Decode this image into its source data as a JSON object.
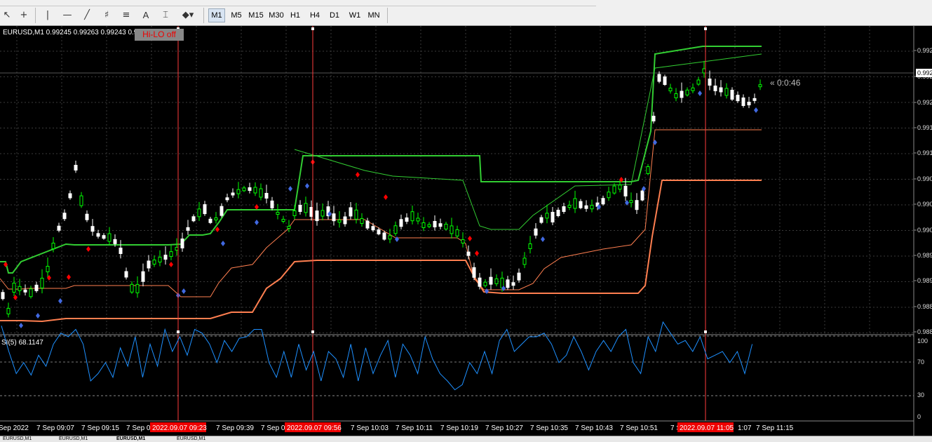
{
  "toolbar": {
    "timeframes": [
      "M1",
      "M5",
      "M15",
      "M30",
      "H1",
      "H4",
      "D1",
      "W1",
      "MN"
    ],
    "active_timeframe": "M1",
    "tools": [
      "cursor-icon",
      "crosshair-icon",
      "vertical-line-icon",
      "horizontal-line-icon",
      "trendline-icon",
      "fibonacci-fan-icon",
      "fibonacci-retracement-icon",
      "text-icon",
      "text-label-icon",
      "shapes-dropdown-icon"
    ]
  },
  "chart": {
    "symbol_info": "EURUSD,M1  0.99245 0.99263 0.99243 0.99",
    "hilo_button": "Hi-LO off",
    "countdown": "« 0:0:46",
    "current_price_label": "0.992",
    "price_axis": [
      "0.992",
      "0.992",
      "0.992",
      "0.991",
      "0.991",
      "0.990",
      "0.990",
      "0.990",
      "0.989",
      "0.989",
      "0.988",
      "0.988"
    ],
    "rsi_label": "SI(5) 68.1147",
    "rsi_axis": [
      "100",
      "70",
      "30",
      "0"
    ],
    "time_axis": [
      "Sep 2022",
      "7 Sep 09:07",
      "7 Sep 09:15",
      "7 Sep 0",
      "7 Sep 09:39",
      "7 Sep 0",
      "7 Sep 10:03",
      "7 Sep 10:11",
      "7 Sep 10:19",
      "7 Sep 10:27",
      "7 Sep 10:35",
      "7 Sep 10:43",
      "7 Sep 10:51",
      "7 Se",
      "1:07",
      "7 Sep 11:15"
    ],
    "vline_labels": [
      "2022.09.07 09:23",
      "2022.09.07 09:56",
      "2022.09.07 11:05"
    ],
    "colors": {
      "background": "#000000",
      "bull": "#ffffff",
      "bear": "#00ff00",
      "upper_band": "#32cd32",
      "lower_band": "#ff7f50",
      "rsi_line": "#1e90ff",
      "vline": "#ff3b3b",
      "signal_up": "#ff0000",
      "signal_down": "#4169e1"
    }
  },
  "bottom_tabs": [
    "EURUSD,M1",
    "EURUSD,M1",
    "EURUSD,M1",
    "EURUSD,M1"
  ]
}
